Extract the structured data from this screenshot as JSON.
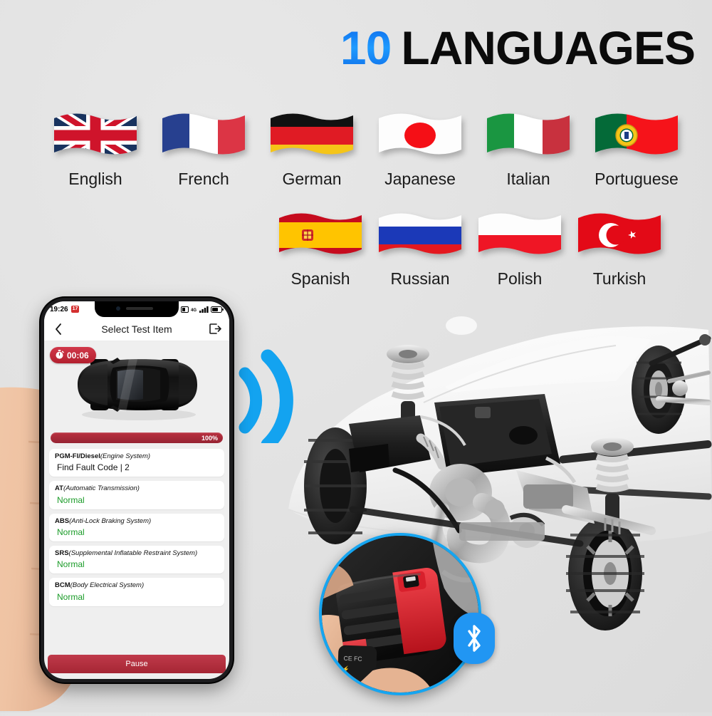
{
  "headline": {
    "number": "10",
    "word": "LANGUAGES",
    "number_color": "#0d6ae6",
    "word_color": "#0b0b0b"
  },
  "languages": {
    "row1": [
      {
        "label": "English",
        "flag": "uk-flag-icon"
      },
      {
        "label": "French",
        "flag": "france-flag-icon"
      },
      {
        "label": "German",
        "flag": "germany-flag-icon"
      },
      {
        "label": "Japanese",
        "flag": "japan-flag-icon"
      },
      {
        "label": "Italian",
        "flag": "italy-flag-icon"
      },
      {
        "label": "Portuguese",
        "flag": "portugal-flag-icon"
      }
    ],
    "row2": [
      {
        "label": "Spanish",
        "flag": "spain-flag-icon"
      },
      {
        "label": "Russian",
        "flag": "russia-flag-icon"
      },
      {
        "label": "Polish",
        "flag": "poland-flag-icon"
      },
      {
        "label": "Turkish",
        "flag": "turkey-flag-icon"
      }
    ]
  },
  "phone": {
    "statusbar": {
      "time": "19:26",
      "badge": "17",
      "network": "4G",
      "icons": [
        "alarm-icon",
        "signal-bars-icon",
        "battery-icon"
      ]
    },
    "navbar": {
      "title": "Select Test Item",
      "back_icon": "back-chevron-icon",
      "exit_icon": "exit-icon"
    },
    "timer": {
      "value": "00:06",
      "icon": "stopwatch-icon"
    },
    "vehicle_image": "car-top-view",
    "progress": {
      "percent_label": "100%",
      "value": 100,
      "color": "#a52634"
    },
    "test_items": [
      {
        "code": "PGM-FI/Diesel",
        "description": "(Engine System)",
        "status": "Find Fault Code | 2",
        "status_type": "fault"
      },
      {
        "code": "AT",
        "description": "(Automatic Transmission)",
        "status": "Normal",
        "status_type": "normal"
      },
      {
        "code": "ABS",
        "description": "(Anti-Lock Braking System)",
        "status": "Normal",
        "status_type": "normal"
      },
      {
        "code": "SRS",
        "description": "(Supplemental Inflatable Restraint System)",
        "status": "Normal",
        "status_type": "normal"
      },
      {
        "code": "BCM",
        "description": "(Body Electrical System)",
        "status": "Normal",
        "status_type": "normal"
      }
    ],
    "pause_button": "Pause"
  },
  "scene": {
    "wifi_icon": "wifi-signal-icon",
    "wifi_color": "#13a3f0",
    "bluetooth_icon": "bluetooth-icon",
    "bluetooth_color": "#2196f3",
    "obd_inset_icon": "obd2-scanner-in-hand",
    "background_icon": "car-chassis-engine-cutaway",
    "hand_icon": "hand-holding-phone"
  }
}
